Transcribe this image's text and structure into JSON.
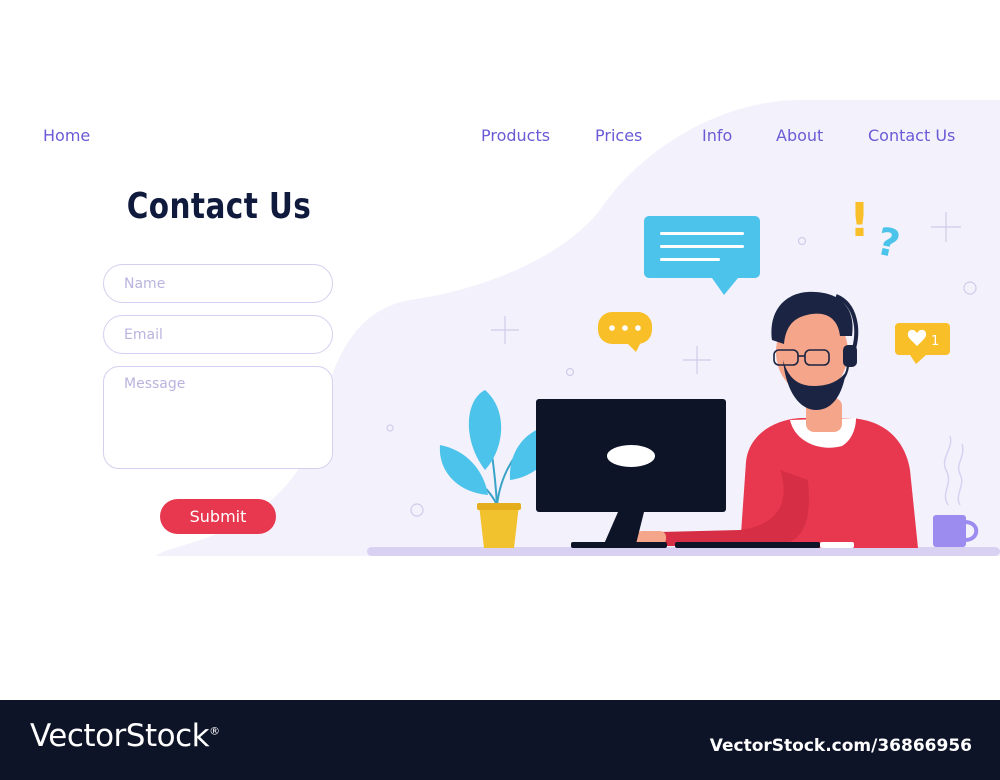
{
  "nav": {
    "home": "Home",
    "products": "Products",
    "prices": "Prices",
    "info": "Info",
    "about": "About",
    "contact": "Contact Us"
  },
  "form": {
    "title": "Contact Us",
    "name_placeholder": "Name",
    "email_placeholder": "Email",
    "message_placeholder": "Message",
    "submit_label": "Submit"
  },
  "illustration": {
    "exclamation": "!",
    "question": "?",
    "like_count": "1"
  },
  "watermark": {
    "logo": "VectorStock",
    "registered": "®",
    "id_text": "VectorStock.com/36866956"
  },
  "colors": {
    "nav_text": "#6a5ad6",
    "title_text": "#0f1a3d",
    "accent_red": "#e8384f",
    "field_border": "#d4d0ef",
    "blob_fill": "#f3f2fc",
    "speech_blue": "#4cc3ea",
    "speech_yellow": "#f9bf29",
    "watermark_bg": "#0e1428"
  }
}
